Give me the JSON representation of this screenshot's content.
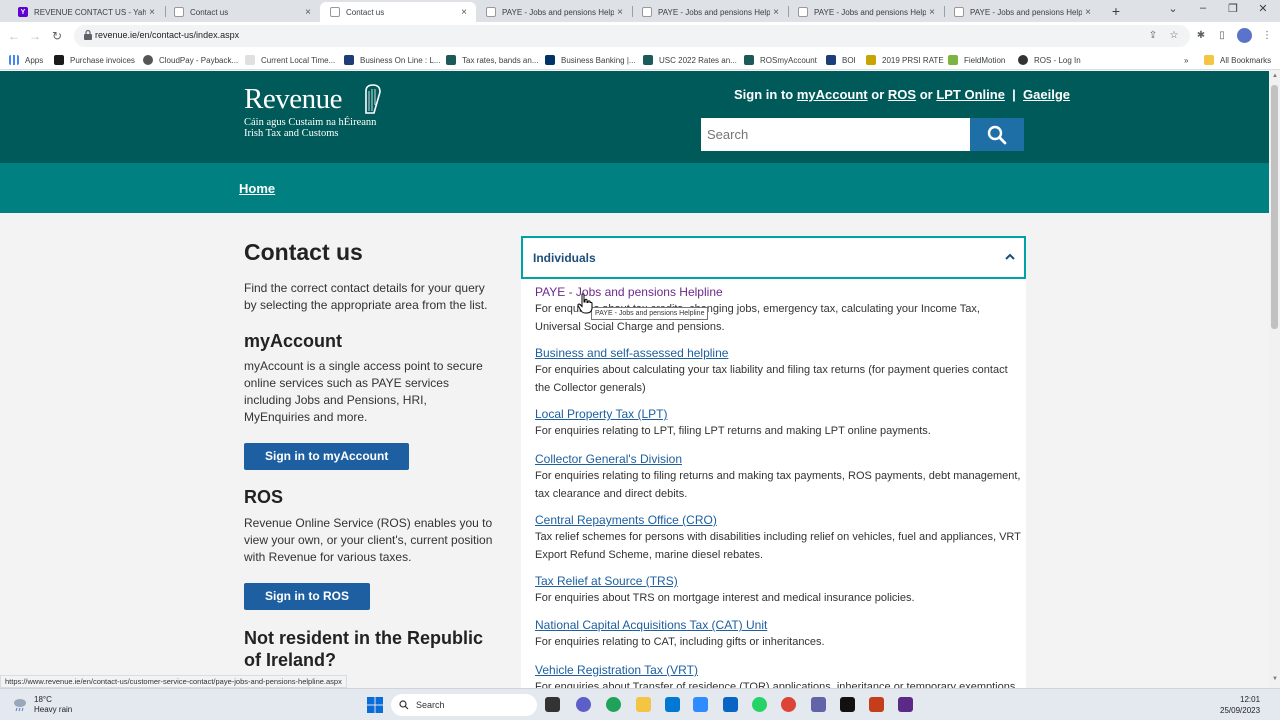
{
  "browser": {
    "tabs": [
      {
        "label": "REVENUE CONTACT US - Yahoo",
        "favicon": "yahoo-icon",
        "favicon_color": "#6001d2"
      },
      {
        "label": "Contact us",
        "favicon": "revenue-icon",
        "favicon_color": "#ffffff"
      },
      {
        "label": "Contact us",
        "favicon": "revenue-icon",
        "favicon_color": "#ffffff",
        "active": true
      },
      {
        "label": "PAYE - Jobs and pensions Helpli",
        "favicon": "revenue-icon",
        "favicon_color": "#ffffff"
      },
      {
        "label": "PAYE - Jobs and pensions Helpli",
        "favicon": "revenue-icon",
        "favicon_color": "#ffffff"
      },
      {
        "label": "PAYE - Jobs and pensions Helpli",
        "favicon": "revenue-icon",
        "favicon_color": "#ffffff"
      },
      {
        "label": "PAYE - Jobs and pensions Helpli",
        "favicon": "revenue-icon",
        "favicon_color": "#ffffff"
      }
    ],
    "url": "revenue.ie/en/contact-us/index.aspx",
    "bookmarks": [
      {
        "label": "Apps",
        "icon": "apps-grid-icon"
      },
      {
        "label": "Purchase invoices",
        "icon": "bookmark-icon"
      },
      {
        "label": "CloudPay - Payback...",
        "icon": "bookmark-icon"
      },
      {
        "label": "Current Local Time...",
        "icon": "bookmark-icon"
      },
      {
        "label": "Business On Line : L...",
        "icon": "bookmark-icon"
      },
      {
        "label": "Tax rates, bands an...",
        "icon": "bookmark-icon"
      },
      {
        "label": "Business Banking |...",
        "icon": "bookmark-icon"
      },
      {
        "label": "USC 2022 Rates an...",
        "icon": "bookmark-icon"
      },
      {
        "label": "ROSmyAccount",
        "icon": "bookmark-icon"
      },
      {
        "label": "BOI",
        "icon": "bookmark-icon"
      },
      {
        "label": "2019 PRSI RATE",
        "icon": "bookmark-icon"
      },
      {
        "label": "FieldMotion",
        "icon": "bookmark-icon"
      },
      {
        "label": "ROS - Log In",
        "icon": "bookmark-icon"
      },
      {
        "label": "All Bookmarks",
        "icon": "folder-icon"
      }
    ],
    "status_url": "https://www.revenue.ie/en/contact-us/customer-service-contact/paye-jobs-and-pensions-helpline.aspx"
  },
  "header": {
    "logo_wordmark": "Revenue",
    "logo_line1": "Cáin agus Custaim na hÉireann",
    "logo_line2": "Irish Tax and Customs",
    "signin_prefix": "Sign in to",
    "link_myaccount": "myAccount",
    "or1": "or",
    "link_ros": "ROS",
    "or2": "or",
    "link_lpt": "LPT Online",
    "separator": "|",
    "link_gaeilge": "Gaeilge",
    "search_placeholder": "Search",
    "colors": {
      "header_bg": "#005a5a",
      "breadcrumb_bg": "#008080",
      "button_bg": "#1d5fa0"
    }
  },
  "breadcrumb": {
    "home": "Home"
  },
  "left": {
    "title": "Contact us",
    "intro": "Find the correct contact details for your query by selecting the appropriate area from the list.",
    "myaccount_heading": "myAccount",
    "myaccount_text": "myAccount is a single access point to secure online services such as PAYE services including Jobs and Pensions, HRI, MyEnquiries and more.",
    "myaccount_button": "Sign in to myAccount",
    "ros_heading": "ROS",
    "ros_text": "Revenue Online Service (ROS) enables you to view your own, or your client's, current position with Revenue for various taxes.",
    "ros_button": "Sign in to ROS",
    "nonresident_heading": "Not resident in the Republic of Ireland?"
  },
  "panel": {
    "title": "Individuals",
    "entries": [
      {
        "link": "PAYE - Jobs and pensions Helpline",
        "desc": "For enquiries about tax credits, changing jobs, emergency tax, calculating your Income Tax, Universal Social Charge and pensions."
      },
      {
        "link": "Business and self-assessed helpline",
        "desc": "For enquiries about calculating your tax liability and filing tax returns (for payment queries contact the Collector generals)"
      },
      {
        "link": "Local Property Tax (LPT)",
        "desc": "For enquiries relating to LPT, filing LPT returns and making LPT online payments."
      },
      {
        "link": "Collector General's Division",
        "desc": "For enquiries relating to filing returns and making tax payments, ROS payments, debt management, tax clearance and direct debits."
      },
      {
        "link": "Central Repayments Office (CRO)",
        "desc": "Tax relief schemes for persons with disabilities including relief on vehicles, fuel and appliances, VRT Export Refund Scheme, marine diesel rebates."
      },
      {
        "link": "Tax Relief at Source (TRS)",
        "desc": "For enquiries about TRS on mortgage interest and medical insurance policies."
      },
      {
        "link": "National Capital Acquisitions Tax (CAT) Unit",
        "desc": "For enquiries relating to CAT, including gifts or inheritances."
      },
      {
        "link": "Vehicle Registration Tax (VRT)",
        "desc": "For enquiries about Transfer of residence (TOR) applications, inheritance or temporary exemptions"
      }
    ],
    "tooltip": "PAYE - Jobs and pensions Helpline"
  },
  "taskbar": {
    "temperature": "18°C",
    "weather": "Heavy rain",
    "search_label": "Search",
    "time": "12:01",
    "date": "25/09/2023"
  }
}
